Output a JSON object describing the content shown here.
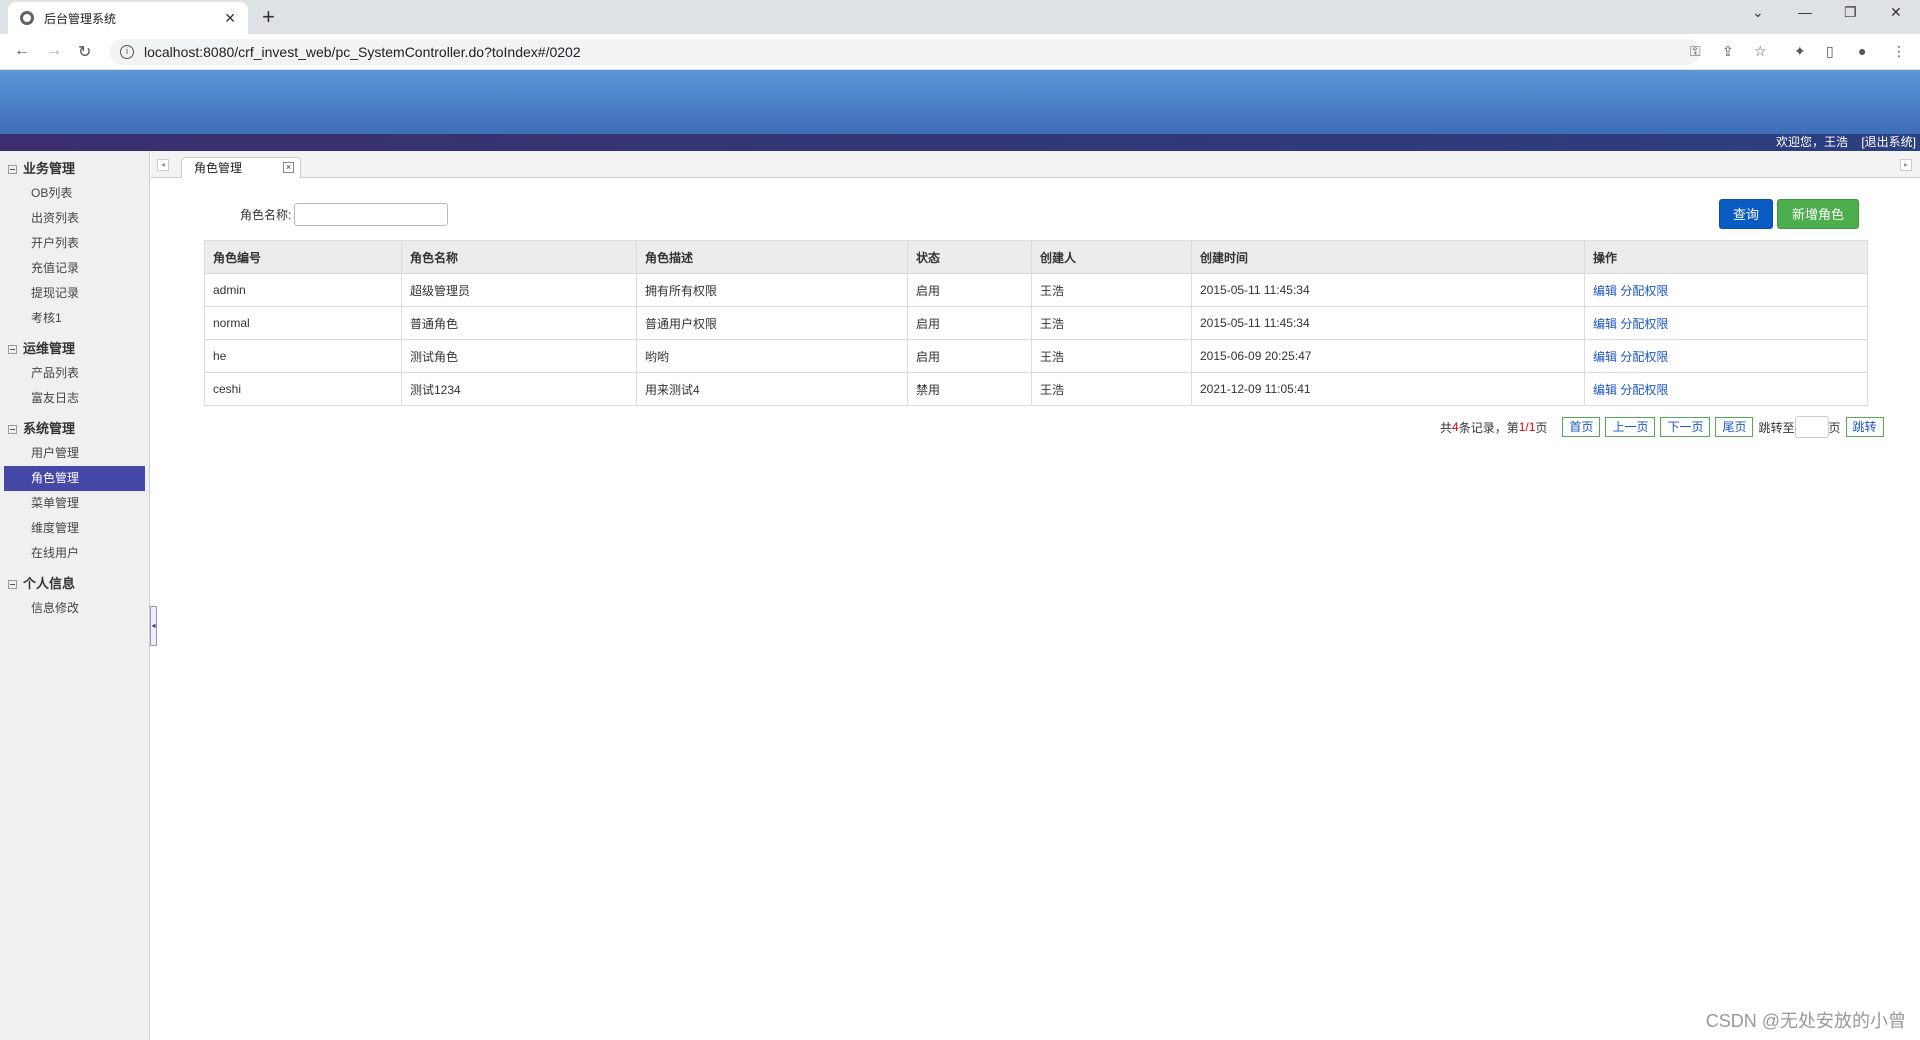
{
  "browser": {
    "tab_title": "后台管理系统",
    "url": "localhost:8080/crf_invest_web/pc_SystemController.do?toIndex#/0202"
  },
  "header": {
    "welcome": "欢迎您，王浩",
    "logout": "[退出系统]"
  },
  "sidebar": {
    "groups": [
      {
        "title": "业务管理",
        "items": [
          "OB列表",
          "出资列表",
          "开户列表",
          "充值记录",
          "提现记录",
          "考核1"
        ]
      },
      {
        "title": "运维管理",
        "items": [
          "产品列表",
          "富友日志"
        ]
      },
      {
        "title": "系统管理",
        "items": [
          "用户管理",
          "角色管理",
          "菜单管理",
          "维度管理",
          "在线用户"
        ]
      },
      {
        "title": "个人信息",
        "items": [
          "信息修改"
        ]
      }
    ],
    "active_item": "角色管理"
  },
  "content_tab": {
    "label": "角色管理"
  },
  "search": {
    "label": "角色名称:",
    "value": "",
    "query_button": "查询",
    "add_button": "新增角色"
  },
  "table": {
    "headers": [
      "角色编号",
      "角色名称",
      "角色描述",
      "状态",
      "创建人",
      "创建时间",
      "操作"
    ],
    "rows": [
      [
        "admin",
        "超级管理员",
        "拥有所有权限",
        "启用",
        "王浩",
        "2015-05-11 11:45:34"
      ],
      [
        "normal",
        "普通角色",
        "普通用户权限",
        "启用",
        "王浩",
        "2015-05-11 11:45:34"
      ],
      [
        "he",
        "测试角色",
        "哟哟",
        "启用",
        "王浩",
        "2015-06-09 20:25:47"
      ],
      [
        "ceshi",
        "测试1234",
        "用来测试4",
        "禁用",
        "王浩",
        "2021-12-09 11:05:41"
      ]
    ],
    "action_edit": "编辑",
    "action_assign": "分配权限"
  },
  "pager": {
    "prefix": "共",
    "total": "4",
    "mid": "条记录，第",
    "page": "1/1",
    "suffix": "页",
    "first": "首页",
    "prev": "上一页",
    "next": "下一页",
    "last": "尾页",
    "jump_label": "跳转至",
    "jump_unit": "页",
    "jump_button": "跳转"
  },
  "watermark": "CSDN @无处安放的小曾"
}
